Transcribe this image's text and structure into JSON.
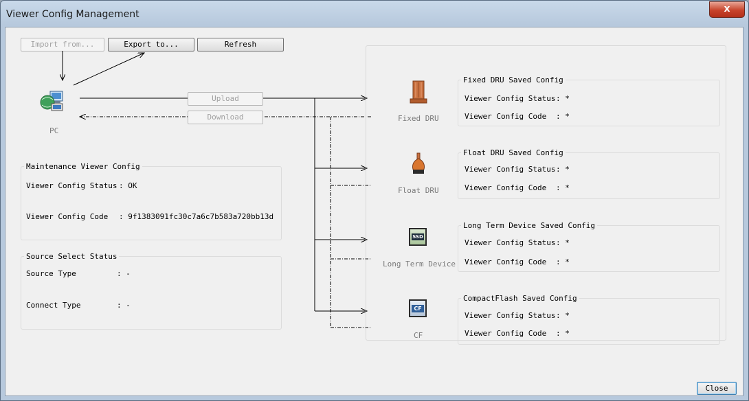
{
  "window": {
    "title": "Viewer Config Management",
    "close_glyph": "x"
  },
  "toolbar": {
    "import_label": "Import from...",
    "export_label": "Export to...",
    "refresh_label": "Refresh"
  },
  "pc": {
    "label": "PC",
    "icon": "pc-network-icon"
  },
  "transfer": {
    "upload_label": "Upload",
    "download_label": "Download"
  },
  "maintenance": {
    "title": "Maintenance Viewer Config",
    "status_label": "Viewer Config Status",
    "status_value": ": OK",
    "code_label": "Viewer Config Code",
    "code_value": ": 9f1383091fc30c7a6c7b583a720bb13d"
  },
  "source": {
    "title": "Source Select Status",
    "type_label": "Source Type",
    "type_value": ": -",
    "connect_label": "Connect Type",
    "connect_value": ": -"
  },
  "devices": [
    {
      "label": "Fixed DRU",
      "icon": "fixed-dru-icon",
      "group_title": "Fixed DRU Saved Config",
      "status_label": "Viewer Config Status",
      "status_value": ": *",
      "code_label": "Viewer Config Code",
      "code_value": ": *"
    },
    {
      "label": "Float DRU",
      "icon": "float-dru-icon",
      "group_title": "Float DRU Saved Config",
      "status_label": "Viewer Config Status",
      "status_value": ": *",
      "code_label": "Viewer Config Code",
      "code_value": ": *"
    },
    {
      "label": "Long Term Device",
      "icon": "ssd-icon",
      "icon_text": "SSD",
      "group_title": "Long Term Device Saved Config",
      "status_label": "Viewer Config Status",
      "status_value": ": *",
      "code_label": "Viewer Config Code",
      "code_value": ": *"
    },
    {
      "label": "CF",
      "icon": "compactflash-icon",
      "icon_text": "CF",
      "group_title": "CompactFlash Saved Config",
      "status_label": "Viewer Config Status",
      "status_value": ": *",
      "code_label": "Viewer Config Code",
      "code_value": ": *"
    }
  ],
  "footer": {
    "close_label": "Close"
  }
}
